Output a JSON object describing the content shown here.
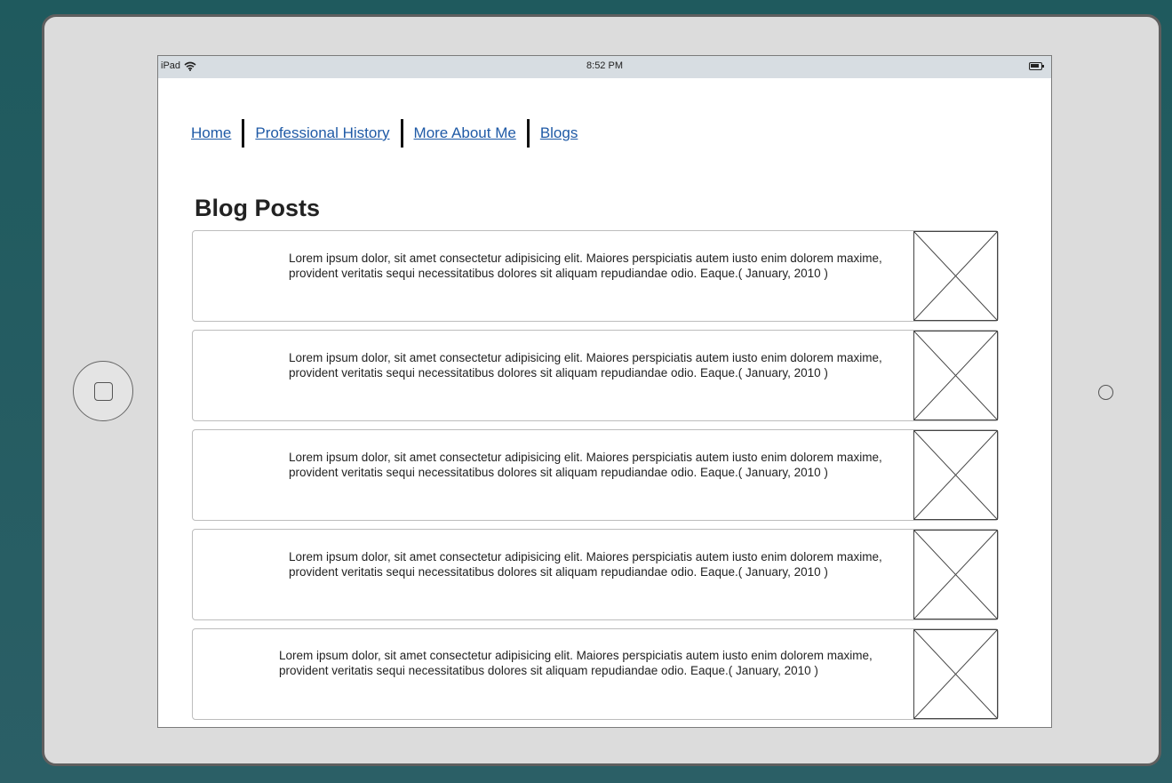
{
  "status_bar": {
    "device": "iPad",
    "time": "8:52 PM"
  },
  "nav": {
    "items": [
      "Home",
      "Professional History",
      "More About Me",
      "Blogs"
    ]
  },
  "page": {
    "title": "Blog Posts"
  },
  "posts": [
    {
      "text": "Lorem ipsum dolor, sit amet consectetur adipisicing elit. Maiores perspiciatis autem iusto enim dolorem maxime, provident veritatis sequi necessitatibus dolores sit aliquam repudiandae odio. Eaque.( January, 2010 )"
    },
    {
      "text": "Lorem ipsum dolor, sit amet consectetur adipisicing elit. Maiores perspiciatis autem iusto enim dolorem maxime, provident veritatis sequi necessitatibus dolores sit aliquam repudiandae odio. Eaque.( January, 2010 )"
    },
    {
      "text": "Lorem ipsum dolor, sit amet consectetur adipisicing elit. Maiores perspiciatis autem iusto enim dolorem maxime, provident veritatis sequi necessitatibus dolores sit aliquam repudiandae odio. Eaque.( January, 2010 )"
    },
    {
      "text": "Lorem ipsum dolor, sit amet consectetur adipisicing elit. Maiores perspiciatis autem iusto enim dolorem maxime, provident veritatis sequi necessitatibus dolores sit aliquam repudiandae odio. Eaque.( January, 2010 )"
    },
    {
      "text": "Lorem ipsum dolor, sit amet consectetur adipisicing elit. Maiores perspiciatis autem iusto enim dolorem maxime, provident veritatis sequi necessitatibus dolores sit aliquam repudiandae odio. Eaque.( January, 2010 )"
    }
  ],
  "colors": {
    "background": "#2b5f66",
    "link": "#1f5aa6",
    "device_frame": "#dcdcdc",
    "status_bar": "#d7dde2"
  },
  "icons": [
    "wifi-icon",
    "battery-icon",
    "home-button-icon",
    "camera-icon",
    "image-placeholder-icon"
  ]
}
